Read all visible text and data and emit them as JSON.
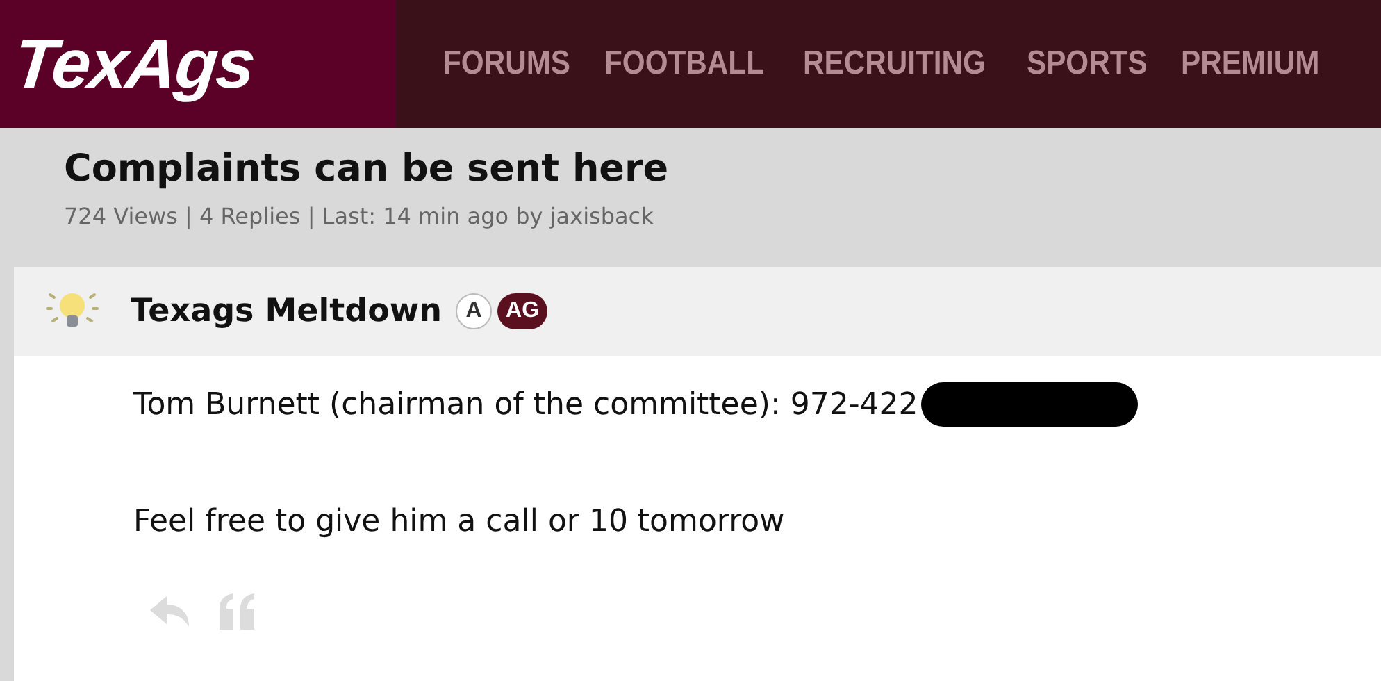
{
  "header": {
    "logo": "TexAgs",
    "nav": [
      {
        "label": "FORUMS"
      },
      {
        "label": "FOOTBALL"
      },
      {
        "label": "RECRUITING"
      },
      {
        "label": "SPORTS"
      },
      {
        "label": "PREMIUM"
      }
    ]
  },
  "thread": {
    "title": "Complaints can be sent here",
    "meta": "724 Views | 4 Replies | Last: 14 min ago by jaxisback"
  },
  "post": {
    "author": "Texags Meltdown",
    "badges": [
      {
        "label": "A",
        "kind": "outline"
      },
      {
        "label": "AG",
        "kind": "filled"
      }
    ],
    "paragraphs": [
      {
        "text": "Tom Burnett (chairman of the committee): 972-422",
        "redacted": true
      },
      {
        "text": "Feel free to give him a call or 10 tomorrow",
        "redacted": false
      }
    ]
  }
}
